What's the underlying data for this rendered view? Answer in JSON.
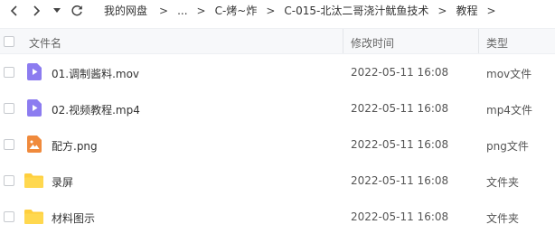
{
  "nav": {
    "back_icon": "chevron-left-icon",
    "forward_icon": "chevron-right-icon",
    "history_icon": "caret-down-icon",
    "refresh_icon": "refresh-icon"
  },
  "breadcrumb": {
    "items": [
      "我的网盘",
      "...",
      "C-烤~炸",
      "C-015-北汰二哥浇汁鱿鱼技术",
      "教程"
    ],
    "separator": ">"
  },
  "table": {
    "headers": {
      "name": "文件名",
      "time": "修改时间",
      "type": "类型"
    },
    "rows": [
      {
        "name": "01.调制酱料.mov",
        "time": "2022-05-11 16:08",
        "type": "mov文件",
        "icon": "video-file-icon"
      },
      {
        "name": "02.视频教程.mp4",
        "time": "2022-05-11 16:08",
        "type": "mp4文件",
        "icon": "video-file-icon"
      },
      {
        "name": "配方.png",
        "time": "2022-05-11 16:08",
        "type": "png文件",
        "icon": "image-file-icon"
      },
      {
        "name": "录屏",
        "time": "2022-05-11 16:08",
        "type": "文件夹",
        "icon": "folder-icon"
      },
      {
        "name": "材料图示",
        "time": "2022-05-11 16:08",
        "type": "文件夹",
        "icon": "folder-icon"
      }
    ]
  },
  "colors": {
    "video_icon": "#8c7cf0",
    "image_icon": "#f08a3c",
    "folder_icon": "#ffcf3d",
    "header_bg": "#f7f8fa"
  }
}
